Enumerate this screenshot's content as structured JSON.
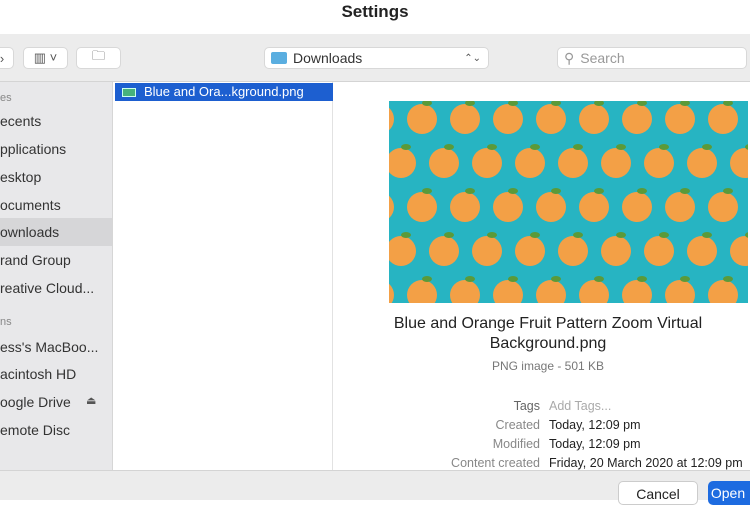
{
  "window": {
    "title": "Settings"
  },
  "toolbar": {
    "view_icon": "column-view-icon",
    "new_folder_icon": "new-folder-icon",
    "location": "Downloads",
    "search_placeholder": "Search"
  },
  "sidebar": {
    "sections": [
      {
        "label": "es"
      },
      {
        "label": "ns"
      }
    ],
    "items": [
      {
        "label": "ecents"
      },
      {
        "label": "pplications"
      },
      {
        "label": "esktop"
      },
      {
        "label": "ocuments"
      },
      {
        "label": "ownloads",
        "selected": true
      },
      {
        "label": "rand Group"
      },
      {
        "label": "reative Cloud..."
      },
      {
        "label": "ess's MacBoo..."
      },
      {
        "label": "acintosh HD"
      },
      {
        "label": "oogle Drive"
      },
      {
        "label": "emote Disc"
      }
    ]
  },
  "files": [
    {
      "name": "Blue and Ora...kground.png",
      "selected": true
    }
  ],
  "preview": {
    "name": "Blue and Orange Fruit Pattern Zoom Virtual Background.png",
    "kind": "PNG image - 501 KB",
    "colors": {
      "background": "#27b4c2",
      "fruit": "#f3a046"
    },
    "meta": [
      {
        "label": "Tags",
        "value": "Add Tags..."
      },
      {
        "label": "Created",
        "value": "Today, 12:09 pm"
      },
      {
        "label": "Modified",
        "value": "Today, 12:09 pm"
      },
      {
        "label": "Content created",
        "value": "Friday, 20 March 2020 at 12:09 pm"
      }
    ]
  },
  "buttons": {
    "cancel": "Cancel",
    "open": "Open"
  }
}
